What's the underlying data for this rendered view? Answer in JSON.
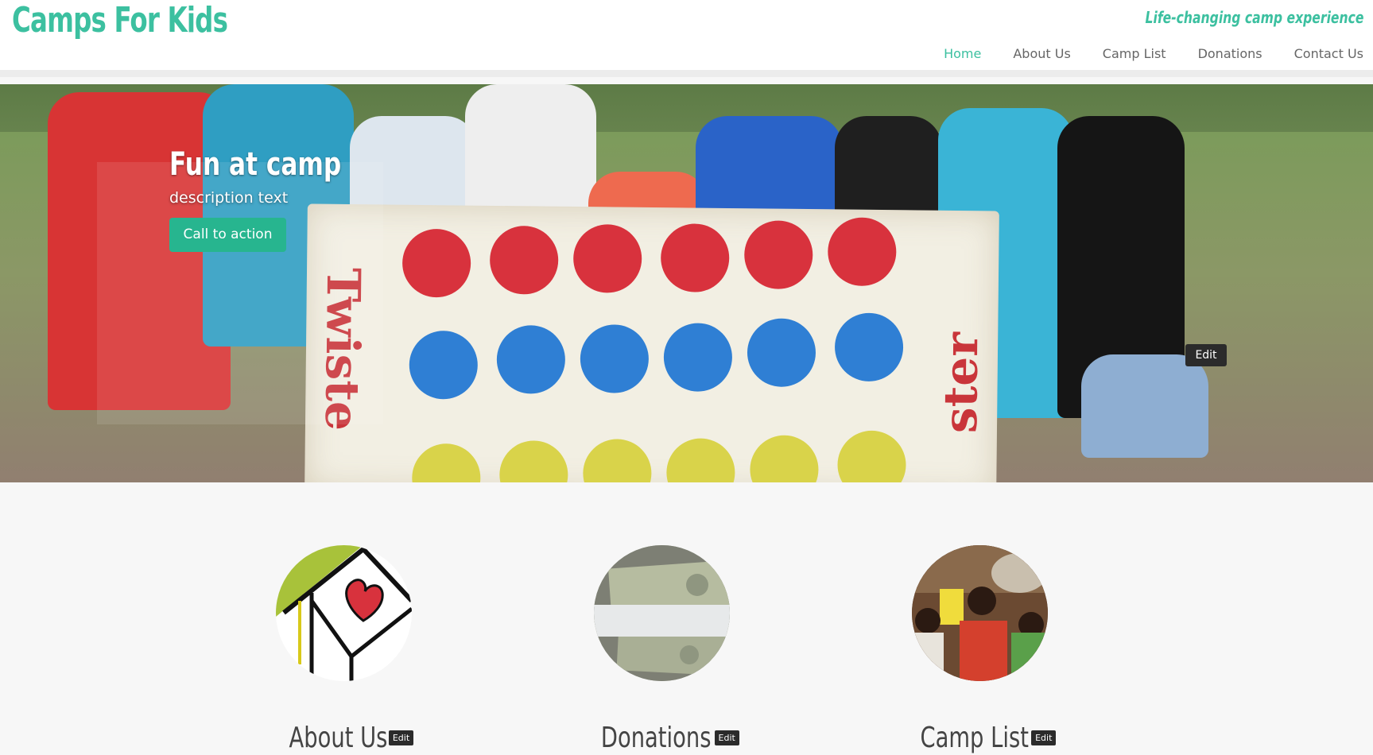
{
  "header": {
    "site_title": "Camps For Kids",
    "tagline": "Life-changing camp experience",
    "nav": [
      {
        "label": "Home",
        "active": true
      },
      {
        "label": "About Us",
        "active": false
      },
      {
        "label": "Camp List",
        "active": false
      },
      {
        "label": "Donations",
        "active": false
      },
      {
        "label": "Contact Us",
        "active": false
      }
    ],
    "accent_color": "#3cc0a0"
  },
  "hero": {
    "title": "Fun at camp",
    "description": "description text",
    "cta_label": "Call to action",
    "edit_label": "Edit",
    "mat_text_left": "Twiste",
    "mat_text_right": "ster",
    "cta_color": "#27b58f"
  },
  "features": [
    {
      "title": "About Us",
      "edit_label": "Edit",
      "image": "camp-heart-logo"
    },
    {
      "title": "Donations",
      "edit_label": "Edit",
      "image": "dollar-bills"
    },
    {
      "title": "Camp List",
      "edit_label": "Edit",
      "image": "kids-photo"
    }
  ]
}
